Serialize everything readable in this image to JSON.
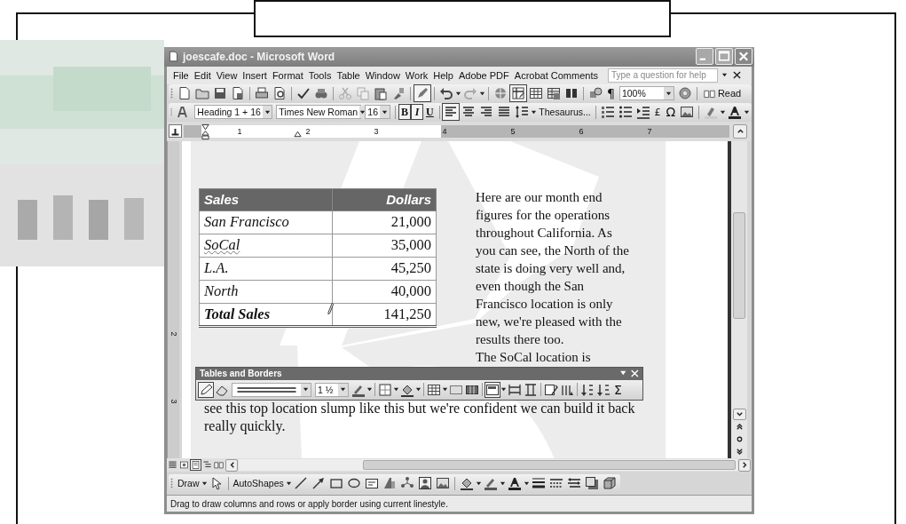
{
  "window": {
    "title": "joescafe.doc - Microsoft Word"
  },
  "menu": [
    {
      "label": "File"
    },
    {
      "label": "Edit"
    },
    {
      "label": "View"
    },
    {
      "label": "Insert"
    },
    {
      "label": "Format"
    },
    {
      "label": "Tools"
    },
    {
      "label": "Table"
    },
    {
      "label": "Window"
    },
    {
      "label": "Work"
    },
    {
      "label": "Help"
    },
    {
      "label": "Adobe PDF"
    },
    {
      "label": "Acrobat Comments"
    }
  ],
  "help_box": {
    "placeholder": "Type a question for help"
  },
  "standard_toolbar": {
    "toggles": [
      {
        "selected": true
      },
      {
        "selected": true
      }
    ],
    "pilcrow": "¶",
    "zoom": "100%",
    "read_button": "Read"
  },
  "formatting_toolbar": {
    "style": "Heading 1 + 16",
    "font": "Times New Roman",
    "size": "16",
    "styles": [
      {
        "label": "B",
        "selected": true
      },
      {
        "label": "I",
        "selected": true
      },
      {
        "label": "U",
        "selected": false
      }
    ],
    "alignment": [
      {
        "selected": true
      },
      {
        "selected": false
      },
      {
        "selected": false
      },
      {
        "selected": false
      }
    ],
    "thesaurus": "Thesaurus...",
    "currency": "£",
    "omega": "Ω"
  },
  "ruler": {
    "numbers": [
      "1",
      "2",
      "3",
      "4",
      "5",
      "6",
      "7"
    ]
  },
  "vertical_ruler": {
    "numbers": [
      "2",
      "3"
    ]
  },
  "document": {
    "table": {
      "columns": [
        "Sales",
        "Dollars"
      ],
      "rows": [
        {
          "kind": "data",
          "cells": [
            "San Francisco",
            "21,000"
          ],
          "misspelled": false
        },
        {
          "kind": "data",
          "cells": [
            "SoCal",
            "35,000"
          ],
          "misspelled": true
        },
        {
          "kind": "data",
          "cells": [
            "L.A.",
            "45,250"
          ],
          "misspelled": false
        },
        {
          "kind": "data",
          "cells": [
            "North",
            "40,000"
          ],
          "misspelled": false
        },
        {
          "kind": "total",
          "cells": [
            "Total Sales",
            "141,250"
          ],
          "misspelled": false
        }
      ]
    },
    "side_text": "Here are our month end figures for the operations throughout California. As you can see, the North of the state is doing very well and, even though the San Francisco location is only new, we're pleased with the results there too.",
    "text_above_toolbar": "The SoCal location is",
    "text_below_toolbar": "see this top location slump like this but we're confident we can build it back really quickly."
  },
  "tables_toolbar": {
    "title": "Tables and Borders",
    "toggles": [
      {
        "selected": true
      },
      {
        "selected": false
      },
      {
        "selected": true
      }
    ],
    "line_weight": "1 ½",
    "sum": "Σ"
  },
  "view_buttons": [
    {
      "selected": false
    },
    {
      "selected": false
    },
    {
      "selected": true
    },
    {
      "selected": false
    },
    {
      "selected": false
    }
  ],
  "drawing_toolbar": {
    "draw": "Draw",
    "autoshapes": "AutoShapes"
  },
  "status_bar": {
    "text": "Drag to draw columns and rows or apply border using current linestyle."
  }
}
